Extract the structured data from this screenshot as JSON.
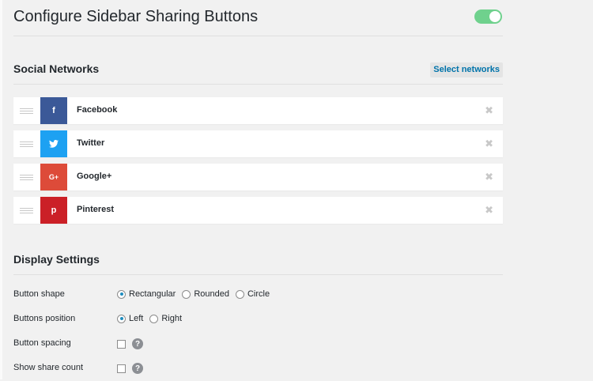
{
  "header": {
    "title": "Configure Sidebar Sharing Buttons",
    "toggle_enabled": true
  },
  "social": {
    "title": "Social Networks",
    "select_label": "Select networks",
    "networks": [
      {
        "label": "Facebook",
        "icon": "f",
        "color": "#3b5998"
      },
      {
        "label": "Twitter",
        "icon": "twitter-bird",
        "color": "#1da1f2"
      },
      {
        "label": "Google+",
        "icon": "G+",
        "color": "#dd4b39"
      },
      {
        "label": "Pinterest",
        "icon": "p",
        "color": "#cb2027"
      }
    ]
  },
  "display": {
    "title": "Display Settings",
    "button_shape": {
      "label": "Button shape",
      "options": [
        "Rectangular",
        "Rounded",
        "Circle"
      ],
      "selected": "Rectangular"
    },
    "buttons_position": {
      "label": "Buttons position",
      "options": [
        "Left",
        "Right"
      ],
      "selected": "Left"
    },
    "button_spacing": {
      "label": "Button spacing",
      "checked": false,
      "help_icon": "question-mark"
    },
    "show_share_count": {
      "label": "Show share count",
      "checked": false,
      "help_icon": "question-mark"
    }
  }
}
